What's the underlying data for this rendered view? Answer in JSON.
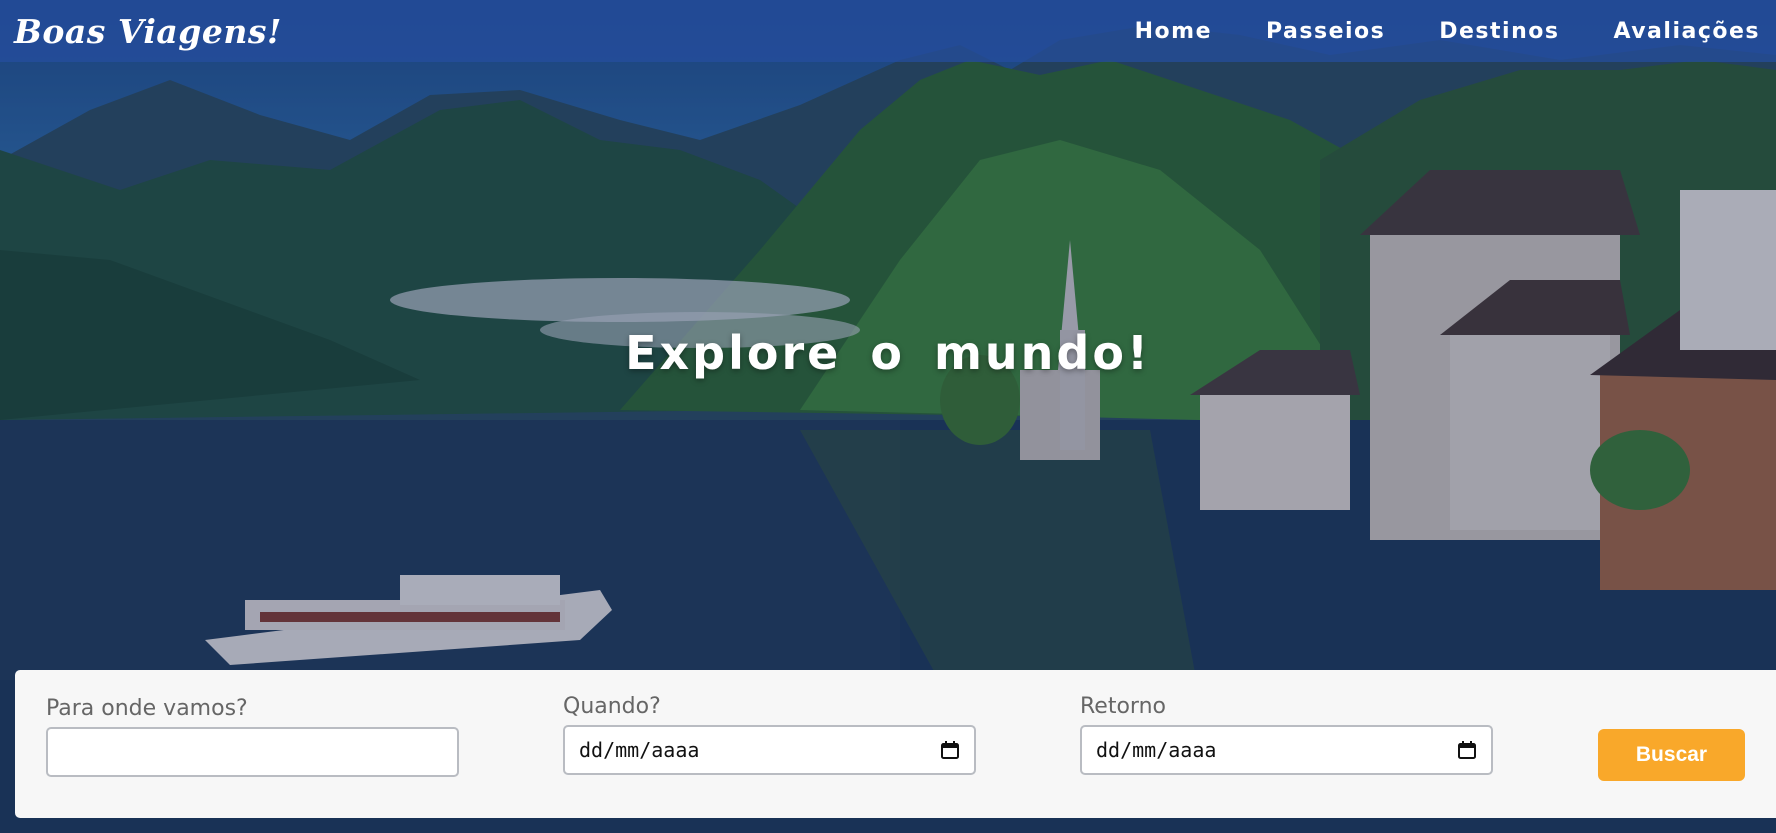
{
  "brand": {
    "name": "Boas Viagens!"
  },
  "nav": {
    "items": [
      "Home",
      "Passeios",
      "Destinos",
      "Avaliações"
    ]
  },
  "hero": {
    "title": "Explore o mundo!"
  },
  "search": {
    "destination": {
      "label": "Para onde vamos?",
      "value": "",
      "placeholder": ""
    },
    "departure": {
      "label": "Quando?",
      "value": "dd/mm/aaaa",
      "icon": "calendar-icon"
    },
    "return": {
      "label": "Retorno",
      "value": "dd/mm/aaaa",
      "icon": "calendar-icon"
    },
    "submit_label": "Buscar"
  },
  "colors": {
    "navbar": "#264ea0",
    "accent_button": "#f9a82a",
    "panel": "#f7f7f7",
    "hero_text": "#ffffff"
  }
}
